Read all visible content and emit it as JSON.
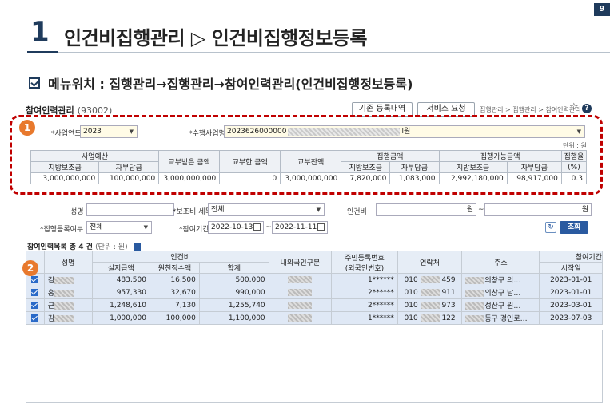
{
  "slide": {
    "number": "1",
    "title": "인건비집행관리 ▷ 인건비집행정보등록",
    "page_badge": "9",
    "menu_location": "메뉴위치 : 집행관리→집행관리→참여인력관리(인건비집행정보등록)"
  },
  "app": {
    "title": "참여인력관리",
    "code": "(93002)",
    "btn_history": "기존 등록내역",
    "btn_service": "서비스 요청",
    "breadcrumb": "집행관리 > 집행관리 > 참여인력관리",
    "star_icon": "star-icon",
    "help_icon": "?"
  },
  "annotations": {
    "badge1": "1",
    "badge2": "2"
  },
  "project": {
    "year_label": "*사업연도",
    "year_value": "2023",
    "project_label": "*수행사업명",
    "project_prefix": "2023626000000",
    "project_suffix": "l원",
    "unit": "단위 : 원"
  },
  "budget_table": {
    "group_headers": {
      "budget": "사업예산",
      "received": "교부받은 금액",
      "granted": "교부한 금액",
      "balance": "교부잔액",
      "executed": "집행금액",
      "executable": "집행가능금액",
      "rate": "집행율"
    },
    "sub_headers": {
      "local1": "지방보조금",
      "self1": "자부담금",
      "local2": "지방보조금",
      "self2": "자부담금",
      "local3": "지방보조금",
      "self3": "자부담금",
      "rate_unit": "(%)"
    },
    "row": {
      "budget_local": "3,000,000,000",
      "budget_self": "100,000,000",
      "received": "3,000,000,000",
      "granted": "0",
      "balance": "3,000,000,000",
      "exec_local": "7,820,000",
      "exec_self": "1,083,000",
      "avail_local": "2,992,180,000",
      "avail_self": "98,917,000",
      "rate": "0.3"
    }
  },
  "search": {
    "name_label": "성명",
    "name_value": "",
    "subsidy_label": "*보조비 세목",
    "subsidy_value": "전체",
    "labor_label": "인건비",
    "labor_from_unit": "원",
    "labor_tilde": "~",
    "labor_to_unit": "원",
    "reg_label": "*집행등록여부",
    "reg_value": "전체",
    "period_label": "*참여기간",
    "date_from": "2022-10-13",
    "date_tilde": "~",
    "date_to": "2022-11-11",
    "refresh_icon": "↻",
    "query_button": "조회"
  },
  "list": {
    "title": "참여인력목록",
    "count": "총 4 건",
    "unit": "(단위 : 원)",
    "headers": {
      "name": "성명",
      "labor": "인건비",
      "actual": "실지급액",
      "withholding": "원천징수액",
      "total": "합계",
      "nationality": "내외국인구분",
      "resident_no": "주민등록번호",
      "resident_no_sub": "(외국인번호)",
      "contact": "연락처",
      "address": "주소",
      "period": "참여기간",
      "start": "시작일"
    },
    "rows": [
      {
        "name": "김",
        "actual": "483,500",
        "withholding": "16,500",
        "total": "500,000",
        "resident": "1******",
        "phone_a": "010",
        "phone_b": "459",
        "address": "의창구 의…",
        "start": "2023-01-01"
      },
      {
        "name": "홍",
        "actual": "957,330",
        "withholding": "32,670",
        "total": "990,000",
        "resident": "2******",
        "phone_a": "010",
        "phone_b": "911",
        "address": "의창구 남…",
        "start": "2023-01-01"
      },
      {
        "name": "근",
        "actual": "1,248,610",
        "withholding": "7,130",
        "total": "1,255,740",
        "resident": "2******",
        "phone_a": "010",
        "phone_b": "973",
        "address": "성산구 원…",
        "start": "2023-03-01"
      },
      {
        "name": "김",
        "actual": "1,000,000",
        "withholding": "100,000",
        "total": "1,100,000",
        "resident": "1******",
        "phone_a": "010",
        "phone_b": "122",
        "address": "동구 경인로…",
        "start": "2023-07-03"
      }
    ]
  }
}
